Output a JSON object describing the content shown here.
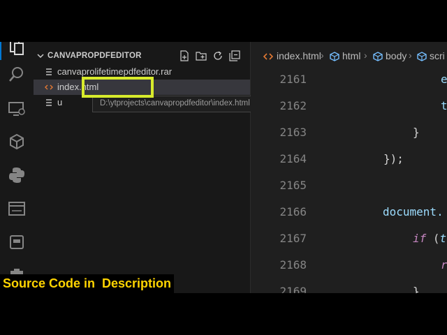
{
  "explorer": {
    "title": "CANVAPROPDFEDITOR",
    "actions": [
      "new-file-icon",
      "new-folder-icon",
      "refresh-icon",
      "collapse-all-icon"
    ],
    "files": [
      {
        "name": "canvaprolifetimepdfeditor.rar"
      },
      {
        "name": "index.html"
      },
      {
        "name": "u"
      }
    ],
    "tooltip": "D:\\ytprojects\\canvapropdfeditor\\index.html",
    "highlight_color": "#d7ea2c"
  },
  "breadcrumb": [
    "index.html",
    "html",
    "body",
    "scri"
  ],
  "editor": {
    "lines": [
      {
        "num": "2161",
        "code": "e"
      },
      {
        "num": "2162",
        "code": "t"
      },
      {
        "num": "2163",
        "code": "}"
      },
      {
        "num": "2164",
        "code": "});"
      },
      {
        "num": "2165",
        "code": ""
      },
      {
        "num": "2166",
        "code": "document."
      },
      {
        "num": "2167",
        "kw": "if",
        "rest": " (",
        "ident2": "t"
      },
      {
        "num": "2168",
        "code": "r"
      },
      {
        "num": "2169",
        "code": "}"
      }
    ]
  },
  "caption": "Source Code in  Description",
  "colors": {
    "caption_text": "#ffd400",
    "caption_bg": "#000000",
    "keyword": "#c586c0",
    "identifier": "#9cdcfe"
  }
}
